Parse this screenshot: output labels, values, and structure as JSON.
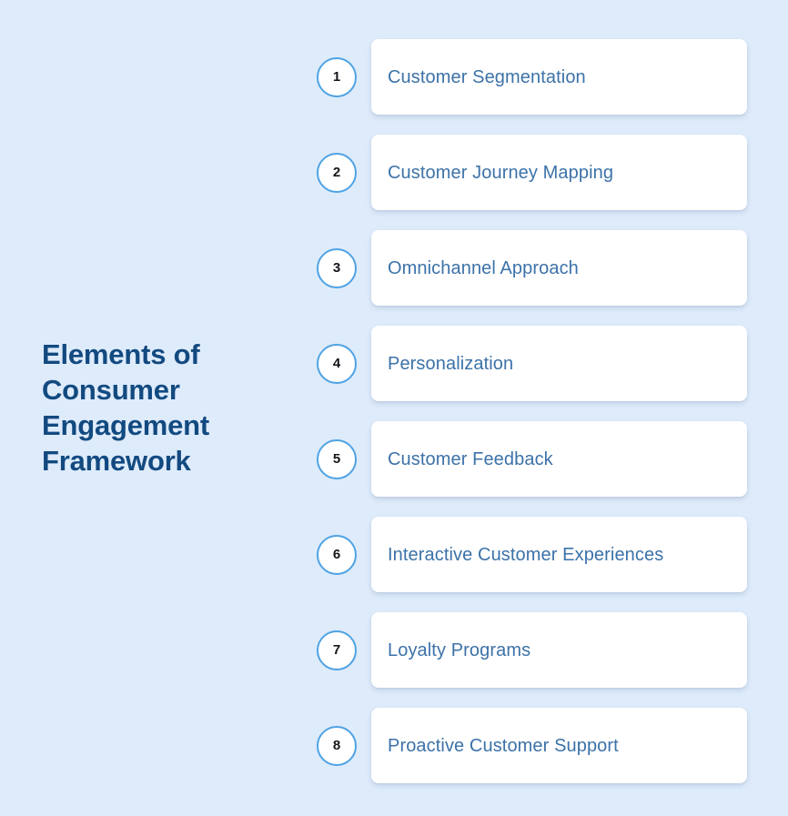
{
  "background_color": "#deebfb",
  "title": {
    "full_text": "Elements of Consumer Engagement Framework",
    "color": "#124a80",
    "lines": [
      "Elements of",
      "Consumer",
      "Engagement",
      "Framework"
    ]
  },
  "theme": {
    "card_background": "#ffffff",
    "card_text_color": "#3c72a8",
    "badge_border_color": "#4fa3e3",
    "badge_background": "#ffffff",
    "badge_number_color": "#14161a"
  },
  "steps": [
    {
      "number": "1",
      "label": "Customer Segmentation"
    },
    {
      "number": "2",
      "label": "Customer Journey Mapping"
    },
    {
      "number": "3",
      "label": "Omnichannel Approach"
    },
    {
      "number": "4",
      "label": "Personalization"
    },
    {
      "number": "5",
      "label": "Customer Feedback"
    },
    {
      "number": "6",
      "label": "Interactive Customer Experiences"
    },
    {
      "number": "7",
      "label": "Loyalty Programs"
    },
    {
      "number": "8",
      "label": "Proactive Customer Support"
    }
  ]
}
